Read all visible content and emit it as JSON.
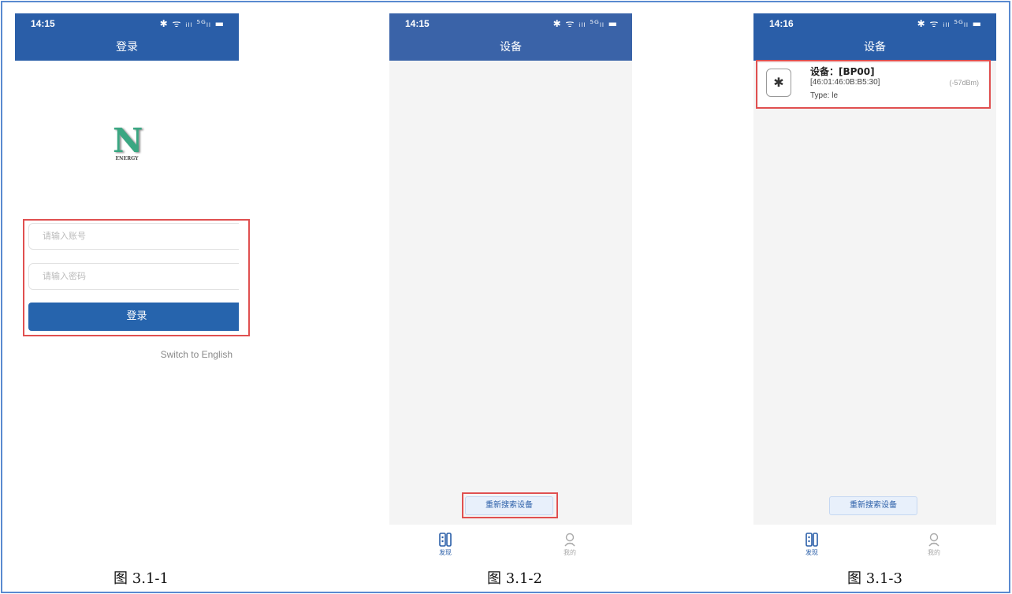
{
  "screens": [
    {
      "status_time": "14:15",
      "status_icons": "✱ ᯤ ᵢₗₗ ⁵ᴳₗₗ ▬",
      "title": "登录",
      "logo_letter": "N",
      "logo_sub": "ENERGY",
      "account_placeholder": "请输入账号",
      "password_placeholder": "请输入密码",
      "login_button": "登录",
      "switch_language": "Switch to English"
    },
    {
      "status_time": "14:15",
      "status_icons": "✱ ᯤ ᵢₗₗ ⁵ᴳₗₗ ▬",
      "title": "设备",
      "rescan_button": "重新搜索设备",
      "tab_discover": "发现",
      "tab_mine": "我的"
    },
    {
      "status_time": "14:16",
      "status_icons": "✱ ᯤ ᵢₗₗ ⁵ᴳₗₗ ▬",
      "title": "设备",
      "device": {
        "name": "设备：[BP00]",
        "mac": "[46:01:46:0B:B5:30]",
        "rssi": "(-57dBm)",
        "type": "Type: le",
        "icon": "bluetooth-icon"
      },
      "rescan_button": "重新搜索设备",
      "tab_discover": "发现",
      "tab_mine": "我的"
    }
  ],
  "captions": [
    "图 3.1-1",
    "图 3.1-2",
    "图 3.1-3"
  ],
  "colors": {
    "primary": "#2a5ea8",
    "highlight": "#e05050",
    "logo_green": "#3aa782",
    "frame": "#5a8ad0"
  }
}
